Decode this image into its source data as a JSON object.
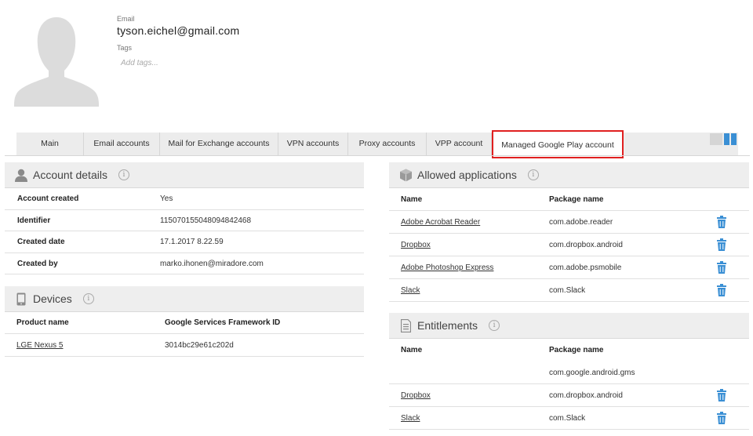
{
  "profile": {
    "email_label": "Email",
    "email": "tyson.eichel@gmail.com",
    "tags_label": "Tags",
    "tags_placeholder": "Add tags..."
  },
  "tabs": [
    {
      "label": "Main"
    },
    {
      "label": "Email accounts"
    },
    {
      "label": "Mail for Exchange accounts"
    },
    {
      "label": "VPN accounts"
    },
    {
      "label": "Proxy accounts"
    },
    {
      "label": "VPP account"
    },
    {
      "label": "Managed Google Play account",
      "active": true
    }
  ],
  "account_details": {
    "title": "Account details",
    "rows": [
      {
        "label": "Account created",
        "value": "Yes"
      },
      {
        "label": "Identifier",
        "value": "115070155048094842468"
      },
      {
        "label": "Created date",
        "value": "17.1.2017 8.22.59"
      },
      {
        "label": "Created by",
        "value": "marko.ihonen@miradore.com"
      }
    ]
  },
  "devices": {
    "title": "Devices",
    "col_product": "Product name",
    "col_gsf": "Google Services Framework ID",
    "rows": [
      {
        "product": "LGE Nexus 5",
        "gsf_id": "3014bc29e61c202d"
      }
    ]
  },
  "allowed_apps": {
    "title": "Allowed applications",
    "col_name": "Name",
    "col_package": "Package name",
    "rows": [
      {
        "name": "Adobe Acrobat Reader",
        "package": "com.adobe.reader"
      },
      {
        "name": "Dropbox",
        "package": "com.dropbox.android"
      },
      {
        "name": "Adobe Photoshop Express",
        "package": "com.adobe.psmobile"
      },
      {
        "name": "Slack",
        "package": "com.Slack"
      }
    ]
  },
  "entitlements": {
    "title": "Entitlements",
    "col_name": "Name",
    "col_package": "Package name",
    "rows": [
      {
        "name": "",
        "package": "com.google.android.gms"
      },
      {
        "name": "Dropbox",
        "package": "com.dropbox.android"
      },
      {
        "name": "Slack",
        "package": "com.Slack"
      }
    ]
  },
  "colors": {
    "accent_blue": "#3a8fd4",
    "active_tab_border": "#e02020",
    "panel_header_bg": "#eeeeee"
  }
}
